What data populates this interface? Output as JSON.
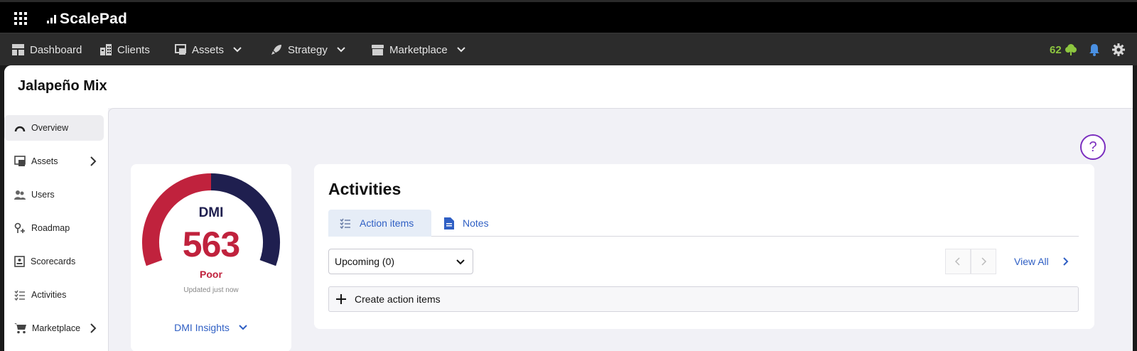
{
  "brand": {
    "name": "ScalePad"
  },
  "nav": {
    "items": [
      {
        "label": "Dashboard",
        "icon": "dashboard-icon"
      },
      {
        "label": "Clients",
        "icon": "building-icon"
      },
      {
        "label": "Assets",
        "icon": "assets-icon",
        "has_menu": true
      },
      {
        "label": "Strategy",
        "icon": "rocket-icon",
        "has_menu": true
      },
      {
        "label": "Marketplace",
        "icon": "store-icon",
        "has_menu": true
      }
    ],
    "points": "62",
    "colors": {
      "points": "#8dc63f",
      "bell": "#4a90e2"
    }
  },
  "page": {
    "title": "Jalapeño Mix"
  },
  "sidebar": {
    "items": [
      {
        "label": "Overview",
        "icon": "gauge-icon",
        "active": true
      },
      {
        "label": "Assets",
        "icon": "assets-icon",
        "has_submenu": true
      },
      {
        "label": "Users",
        "icon": "users-icon"
      },
      {
        "label": "Roadmap",
        "icon": "roadmap-icon"
      },
      {
        "label": "Scorecards",
        "icon": "scorecard-icon"
      },
      {
        "label": "Activities",
        "icon": "checklist-icon"
      },
      {
        "label": "Marketplace",
        "icon": "cart-icon",
        "has_submenu": true
      }
    ]
  },
  "help": {
    "label": "?"
  },
  "dmi": {
    "label": "DMI",
    "score": "563",
    "rating": "Poor",
    "updated": "Updated just now",
    "insights_label": "DMI Insights",
    "gauge_fill_fraction": 0.5,
    "colors": {
      "score": "#c0223d",
      "track": "#1f1f4f"
    }
  },
  "activities": {
    "title": "Activities",
    "tabs": [
      {
        "label": "Action items",
        "icon": "checklist-icon",
        "active": true
      },
      {
        "label": "Notes",
        "icon": "document-icon",
        "active": false
      }
    ],
    "filter": {
      "selected": "Upcoming (0)"
    },
    "view_all_label": "View All",
    "create_label": "Create action items"
  }
}
